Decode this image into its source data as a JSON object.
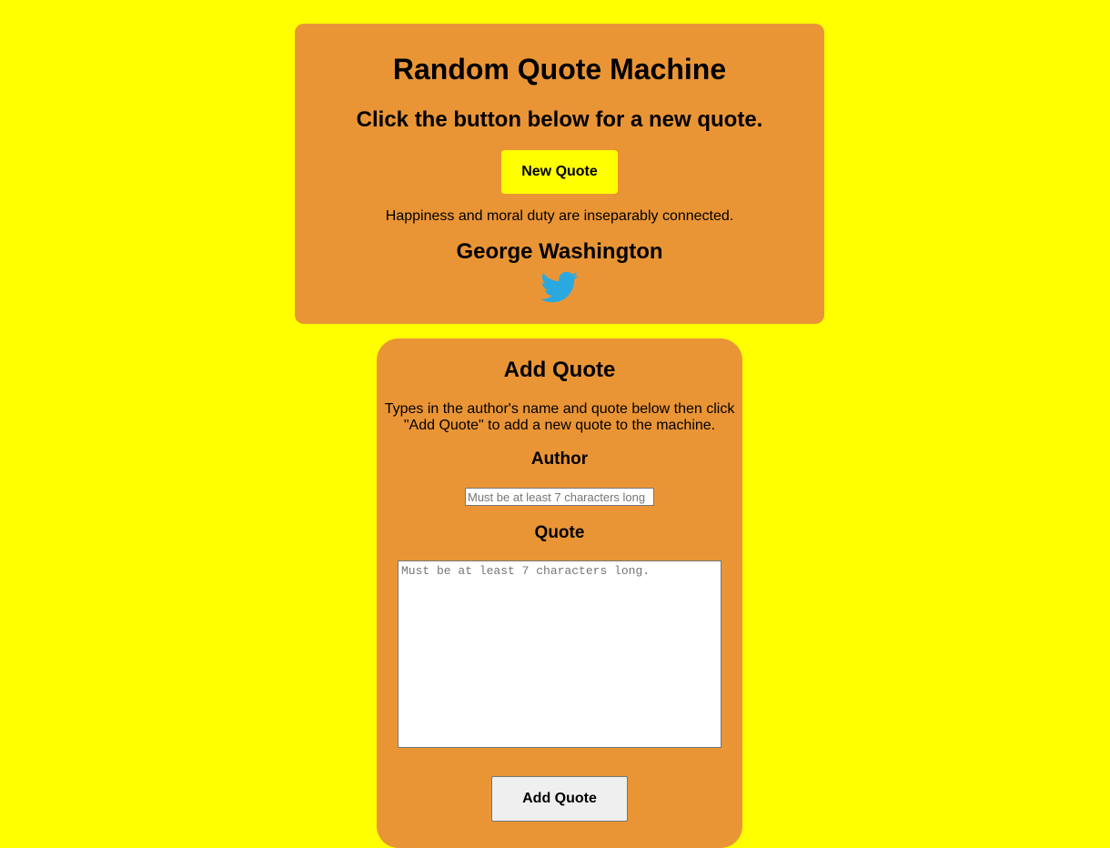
{
  "quote_card": {
    "title": "Random Quote Machine",
    "subtitle": "Click the button below for a new quote.",
    "new_quote_label": "New Quote",
    "quote": "Happiness and moral duty are inseparably connected.",
    "author": "George Washington",
    "share_icon": "twitter-bird-icon"
  },
  "add_card": {
    "title": "Add Quote",
    "instructions": "Types in the author's name and quote below then click \"Add Quote\" to add a new quote to the machine.",
    "author_label": "Author",
    "author_placeholder": "Must be at least 7 characters long",
    "author_value": "",
    "quote_label": "Quote",
    "quote_placeholder": "Must be at least 7 characters long.",
    "quote_value": "",
    "add_button_label": "Add Quote"
  },
  "colors": {
    "page_background": "#ffff00",
    "card_background": "#ea9535",
    "button_yellow": "#ffff00",
    "twitter_blue": "#2aa9e0"
  }
}
